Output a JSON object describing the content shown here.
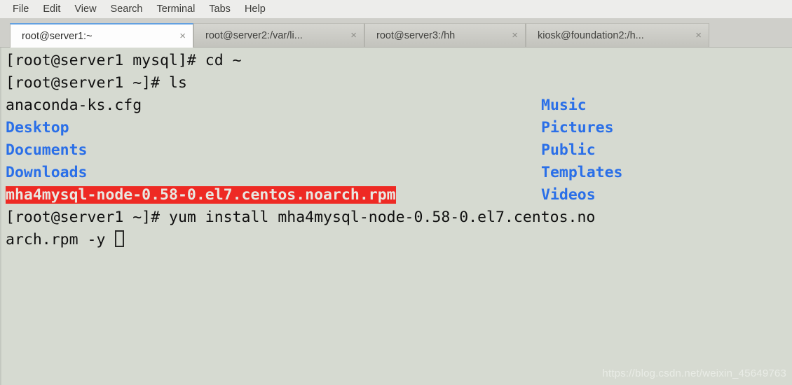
{
  "window": {
    "title": "root@server1:~",
    "menu": [
      {
        "label": "File"
      },
      {
        "label": "Edit"
      },
      {
        "label": "View"
      },
      {
        "label": "Search"
      },
      {
        "label": "Terminal"
      },
      {
        "label": "Tabs"
      },
      {
        "label": "Help"
      }
    ],
    "close_glyph": "×"
  },
  "tabs": [
    {
      "label": "root@server1:~",
      "active": true
    },
    {
      "label": "root@server2:/var/li...",
      "active": false
    },
    {
      "label": "root@server3:/hh",
      "active": false
    },
    {
      "label": "kiosk@foundation2:/h...",
      "active": false
    }
  ],
  "terminal": {
    "colors": {
      "background": "#d6dad1",
      "foreground": "#101010",
      "directory": "#2a6fe8",
      "archive_bg": "#ee2a24",
      "archive_fg": "#e8e8e2"
    },
    "lines": [
      {
        "left": "[root@server1 mysql]# cd ~",
        "left_class": "c-default",
        "right": "",
        "right_class": ""
      },
      {
        "left": "[root@server1 ~]# ls",
        "left_class": "c-default",
        "right": "",
        "right_class": ""
      },
      {
        "left": "anaconda-ks.cfg",
        "left_class": "c-default",
        "right": "Music",
        "right_class": "c-dir"
      },
      {
        "left": "Desktop",
        "left_class": "c-dir",
        "right": "Pictures",
        "right_class": "c-dir"
      },
      {
        "left": "Documents",
        "left_class": "c-dir",
        "right": "Public",
        "right_class": "c-dir"
      },
      {
        "left": "Downloads",
        "left_class": "c-dir",
        "right": "Templates",
        "right_class": "c-dir"
      },
      {
        "left": "mha4mysql-node-0.58-0.el7.centos.noarch.rpm",
        "left_class": "c-archive",
        "right": "Videos",
        "right_class": "c-dir"
      },
      {
        "left": "[root@server1 ~]# yum install mha4mysql-node-0.58-0.el7.centos.no",
        "left_class": "c-default",
        "right": "",
        "right_class": ""
      },
      {
        "left": "arch.rpm -y ",
        "left_class": "c-default",
        "right": "",
        "right_class": "",
        "cursor": true
      }
    ]
  },
  "watermark": {
    "text": "https://blog.csdn.net/weixin_45649763"
  }
}
